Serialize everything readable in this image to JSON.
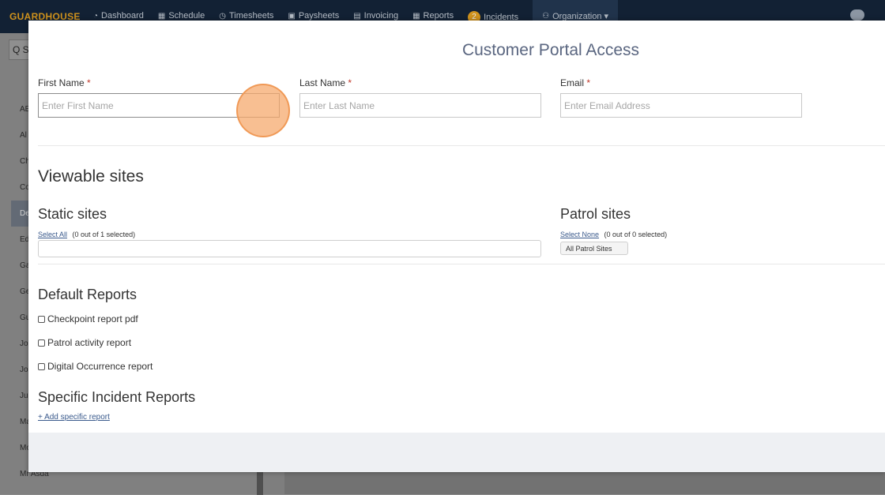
{
  "app": {
    "brand": "GUARDHOUSE",
    "nav": [
      {
        "icon": "dashboard-icon",
        "glyph": "◔",
        "label": "Dashboard"
      },
      {
        "icon": "calendar-icon",
        "glyph": "▦",
        "label": "Schedule"
      },
      {
        "icon": "clock-icon",
        "glyph": "◷",
        "label": "Timesheets"
      },
      {
        "icon": "money-icon",
        "glyph": "▣",
        "label": "Paysheets"
      },
      {
        "icon": "invoice-icon",
        "glyph": "▤",
        "label": "Invoicing"
      },
      {
        "icon": "table-icon",
        "glyph": "▦",
        "label": "Reports"
      },
      {
        "icon": "incidents-badge",
        "badge": "2",
        "label": "Incidents"
      },
      {
        "icon": "users-icon",
        "glyph": "⚇",
        "label": "Organization ▾"
      }
    ],
    "search_glyph": "Q S",
    "sidebar_rows": [
      "AE",
      "Al",
      "Ch",
      "Co",
      "De",
      "Ed",
      "Ga",
      "Ge",
      "Gu",
      "Jo",
      "Jo",
      "Ju",
      "Ma",
      "Mo",
      "Mr Asda"
    ]
  },
  "modal": {
    "title": "Customer Portal Access",
    "first_name": {
      "label": "First Name",
      "required": "*",
      "placeholder": "Enter First Name",
      "value": ""
    },
    "last_name": {
      "label": "Last Name",
      "required": "*",
      "placeholder": "Enter Last Name",
      "value": ""
    },
    "email": {
      "label": "Email",
      "required": "*",
      "placeholder": "Enter Email Address",
      "value": ""
    },
    "viewable_sites_heading": "Viewable sites",
    "static_sites": {
      "heading": "Static sites",
      "select_link": "Select All",
      "count_text": "(0 out of 1 selected)"
    },
    "patrol_sites": {
      "heading": "Patrol sites",
      "select_link": "Select None",
      "count_text": "(0 out of 0 selected)",
      "pill": "All Patrol Sites"
    },
    "default_reports": {
      "heading": "Default Reports",
      "items": [
        "Checkpoint report pdf",
        "Patrol activity report",
        "Digital Occurrence report"
      ]
    },
    "specific_reports": {
      "heading": "Specific Incident Reports",
      "add_link": "+ Add specific report"
    }
  },
  "colors": {
    "brand": "#e8a21c",
    "navbar": "#0f2036",
    "title": "#5a6680",
    "required": "#c0392b",
    "link": "#3a5a8c",
    "click_marker": "#f6aa6e"
  }
}
